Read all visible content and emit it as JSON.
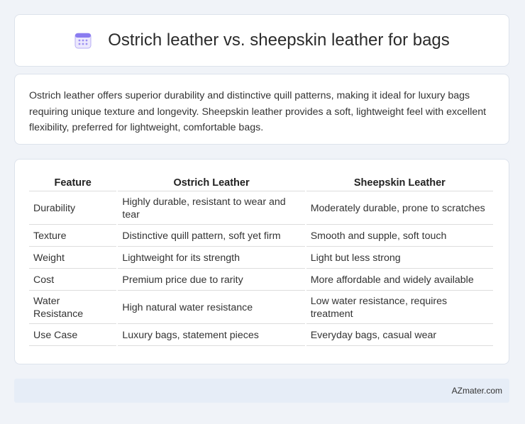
{
  "header": {
    "title": "Ostrich leather vs. sheepskin leather for bags",
    "icon": "calendar-icon",
    "icon_color": "#8a7cf0"
  },
  "summary": {
    "text": "Ostrich leather offers superior durability and distinctive quill patterns, making it ideal for luxury bags requiring unique texture and longevity. Sheepskin leather provides a soft, lightweight feel with excellent flexibility, preferred for lightweight, comfortable bags."
  },
  "table": {
    "headers": [
      "Feature",
      "Ostrich Leather",
      "Sheepskin Leather"
    ],
    "rows": [
      [
        "Durability",
        "Highly durable, resistant to wear and tear",
        "Moderately durable, prone to scratches"
      ],
      [
        "Texture",
        "Distinctive quill pattern, soft yet firm",
        "Smooth and supple, soft touch"
      ],
      [
        "Weight",
        "Lightweight for its strength",
        "Light but less strong"
      ],
      [
        "Cost",
        "Premium price due to rarity",
        "More affordable and widely available"
      ],
      [
        "Water Resistance",
        "High natural water resistance",
        "Low water resistance, requires treatment"
      ],
      [
        "Use Case",
        "Luxury bags, statement pieces",
        "Everyday bags, casual wear"
      ]
    ]
  },
  "footer": {
    "text": "AZmater.com"
  }
}
